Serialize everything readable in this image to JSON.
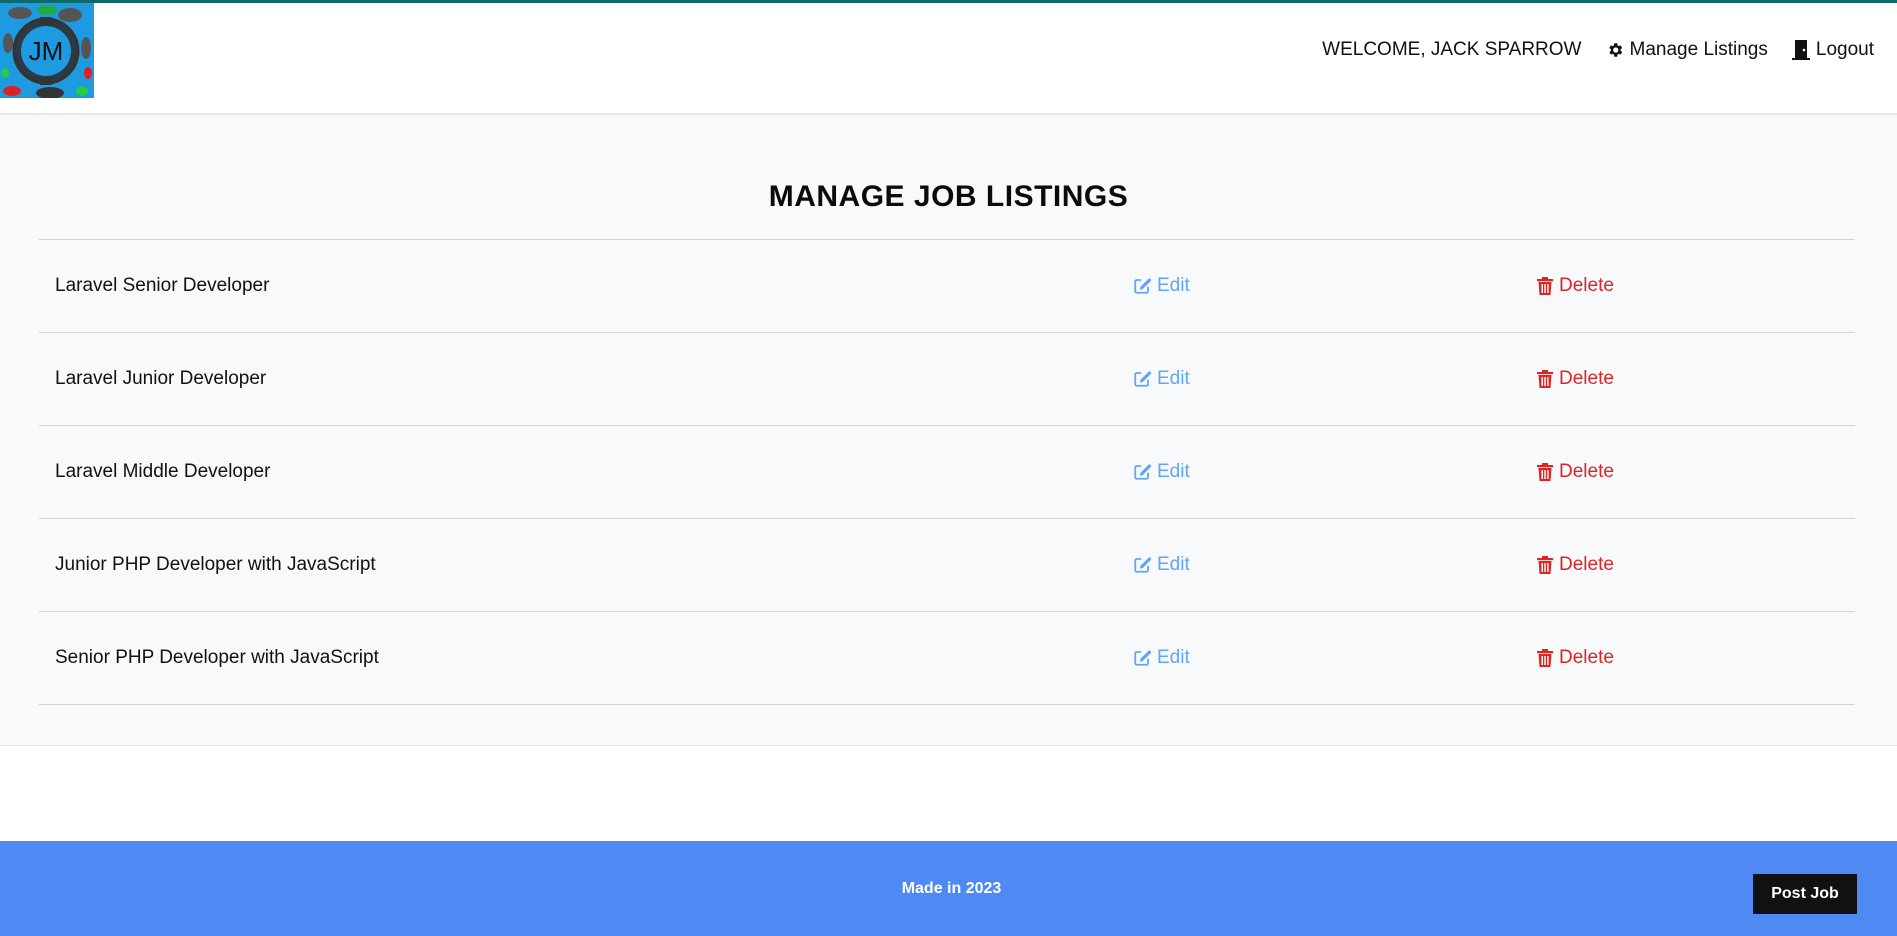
{
  "header": {
    "logo_text": "JM",
    "welcome": "WELCOME, JACK SPARROW",
    "manage_listings": "Manage Listings",
    "logout": "Logout"
  },
  "main": {
    "title": "MANAGE JOB LISTINGS",
    "edit_label": "Edit",
    "delete_label": "Delete",
    "listings": [
      {
        "title": "Laravel Senior Developer"
      },
      {
        "title": "Laravel Junior Developer"
      },
      {
        "title": "Laravel Middle Developer"
      },
      {
        "title": "Junior PHP Developer with JavaScript"
      },
      {
        "title": "Senior PHP Developer with JavaScript"
      }
    ]
  },
  "footer": {
    "text": "Made in 2023",
    "post_job": "Post Job"
  },
  "colors": {
    "edit": "#60a5fa",
    "delete": "#dc2626",
    "footer_bg": "#4f8af4",
    "panel_bg": "#f8f9fa"
  },
  "icons": {
    "logo": "jm-logo",
    "manage": "gear-icon",
    "logout": "door-icon",
    "edit": "pen-to-square-icon",
    "delete": "trash-icon"
  }
}
